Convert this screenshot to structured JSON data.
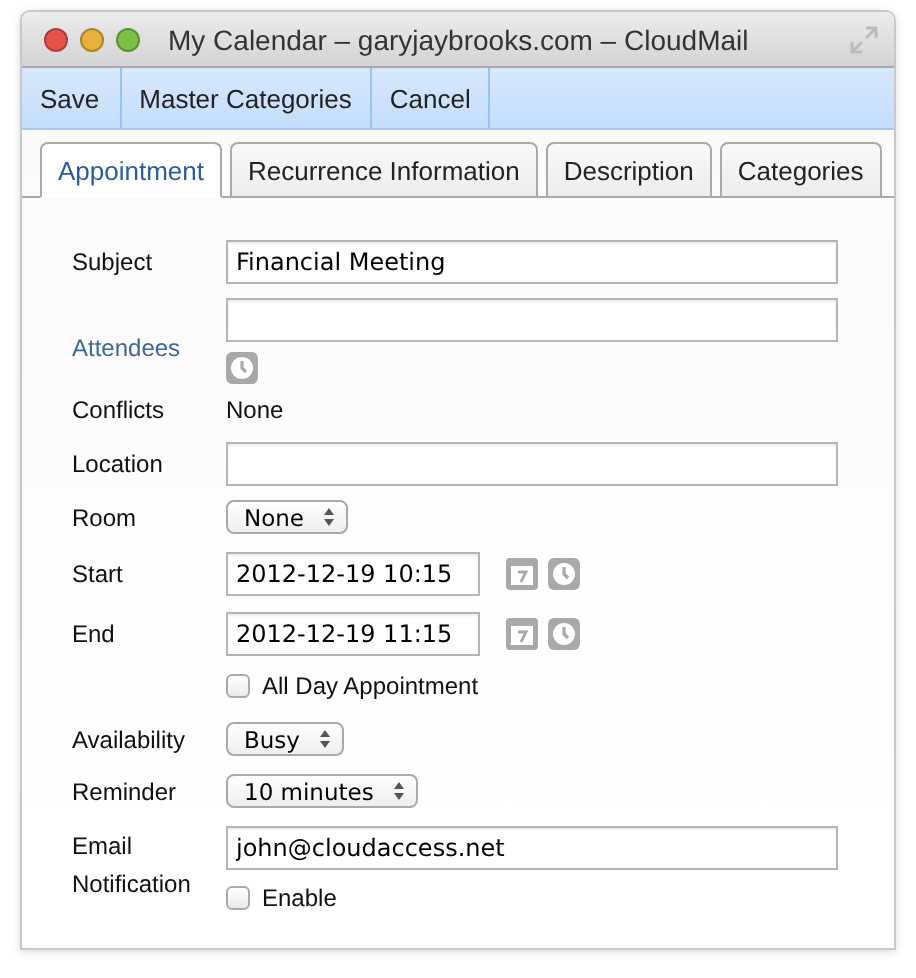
{
  "window": {
    "title": "My Calendar – garyjaybrooks.com – CloudMail"
  },
  "toolbar": [
    "Save",
    "Master Categories",
    "Cancel"
  ],
  "tabs": [
    {
      "label": "Appointment",
      "selected": true
    },
    {
      "label": "Recurrence Information",
      "selected": false
    },
    {
      "label": "Description",
      "selected": false
    },
    {
      "label": "Categories",
      "selected": false
    }
  ],
  "fields": [
    {
      "kind": "text",
      "label": "Subject",
      "value": "Financial Meeting"
    },
    {
      "kind": "picker",
      "label": "Attendees"
    },
    {
      "kind": "static",
      "label": "Conflicts",
      "value": "None"
    },
    {
      "kind": "text",
      "label": "Location"
    },
    {
      "kind": "select",
      "label": "Room",
      "value": "None"
    },
    {
      "kind": "datetime",
      "label": "Start",
      "value": "2012-12-19 10:15"
    },
    {
      "kind": "datetime",
      "label": "End",
      "value": "2012-12-19 11:15"
    },
    {
      "kind": "checkbox",
      "option": "All Day Appointment",
      "checked": false
    },
    {
      "kind": "select",
      "label": "Availability",
      "value": "Busy"
    },
    {
      "kind": "select",
      "label": "Reminder",
      "value": "10 minutes"
    },
    {
      "kind": "email",
      "label": "Email Notification",
      "value": "john@cloudaccess.net",
      "option": "Enable",
      "checked": false
    }
  ]
}
